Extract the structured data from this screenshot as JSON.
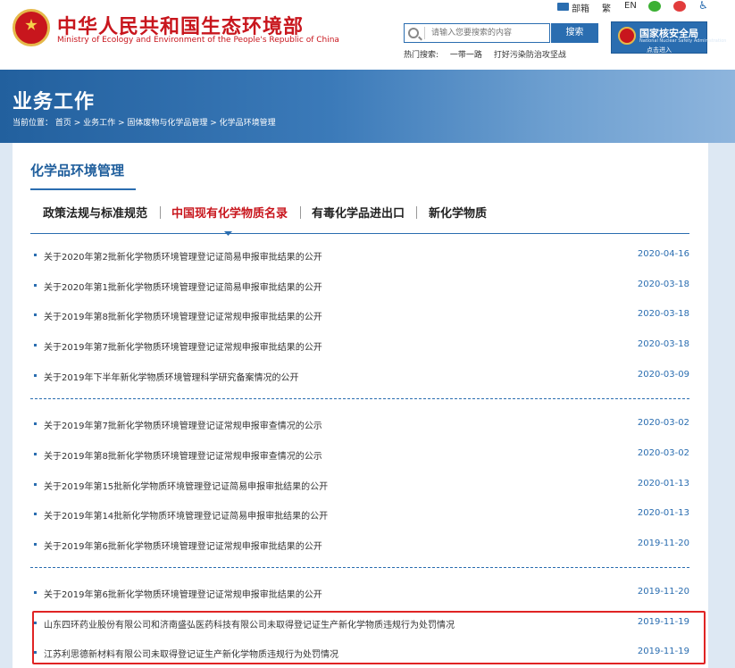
{
  "header": {
    "org_name_cn": "中华人民共和国生态环境部",
    "org_name_en": "Ministry of Ecology and Environment of the People's Republic of China",
    "toplinks": {
      "mail": "部箱",
      "traditional": "繁",
      "english": "EN"
    },
    "search": {
      "placeholder": "请输入您要搜索的内容",
      "button": "搜索"
    },
    "hot_search": {
      "label": "热门搜索:",
      "items": [
        "一带一路",
        "打好污染防治攻坚战"
      ]
    },
    "nsa": {
      "name_cn": "国家核安全局",
      "name_en": "National Nuclear Safety Administration",
      "enter": "点击进入"
    }
  },
  "banner": {
    "title": "业务工作",
    "breadcrumb": "当前位置： 首页 > 业务工作 > 固体废物与化学品管理 > 化学品环境管理"
  },
  "section": {
    "title": "化学品环境管理"
  },
  "tabs": [
    {
      "label": "政策法规与标准规范",
      "active": false
    },
    {
      "label": "中国现有化学物质名录",
      "active": true
    },
    {
      "label": "有毒化学品进出口",
      "active": false
    },
    {
      "label": "新化学物质",
      "active": false
    }
  ],
  "articles": [
    {
      "title": "关于2020年第2批新化学物质环境管理登记证简易申报审批结果的公开",
      "date": "2020-04-16"
    },
    {
      "title": "关于2020年第1批新化学物质环境管理登记证简易申报审批结果的公开",
      "date": "2020-03-18"
    },
    {
      "title": "关于2019年第8批新化学物质环境管理登记证常规申报审批结果的公开",
      "date": "2020-03-18"
    },
    {
      "title": "关于2019年第7批新化学物质环境管理登记证常规申报审批结果的公开",
      "date": "2020-03-18"
    },
    {
      "title": "关于2019年下半年新化学物质环境管理科学研究备案情况的公开",
      "date": "2020-03-09"
    },
    {
      "title": "关于2019年第7批新化学物质环境管理登记证常规申报审查情况的公示",
      "date": "2020-03-02"
    },
    {
      "title": "关于2019年第8批新化学物质环境管理登记证常规申报审查情况的公示",
      "date": "2020-03-02"
    },
    {
      "title": "关于2019年第15批新化学物质环境管理登记证简易申报审批结果的公开",
      "date": "2020-01-13"
    },
    {
      "title": "关于2019年第14批新化学物质环境管理登记证简易申报审批结果的公开",
      "date": "2020-01-13"
    },
    {
      "title": "关于2019年第6批新化学物质环境管理登记证常规申报审批结果的公开",
      "date": "2019-11-20"
    },
    {
      "title": "关于2019年第6批新化学物质环境管理登记证常规申报审批结果的公开",
      "date": "2019-11-20"
    },
    {
      "title": "山东四环药业股份有限公司和济南盛弘医药科技有限公司未取得登记证生产新化学物质违规行为处罚情况",
      "date": "2019-11-19"
    },
    {
      "title": "江苏利思德新材料有限公司未取得登记证生产新化学物质违规行为处罚情况",
      "date": "2019-11-19"
    }
  ],
  "colors": {
    "brand_red": "#c8161d",
    "brand_blue": "#2a6db0",
    "highlight": "#e02424"
  }
}
